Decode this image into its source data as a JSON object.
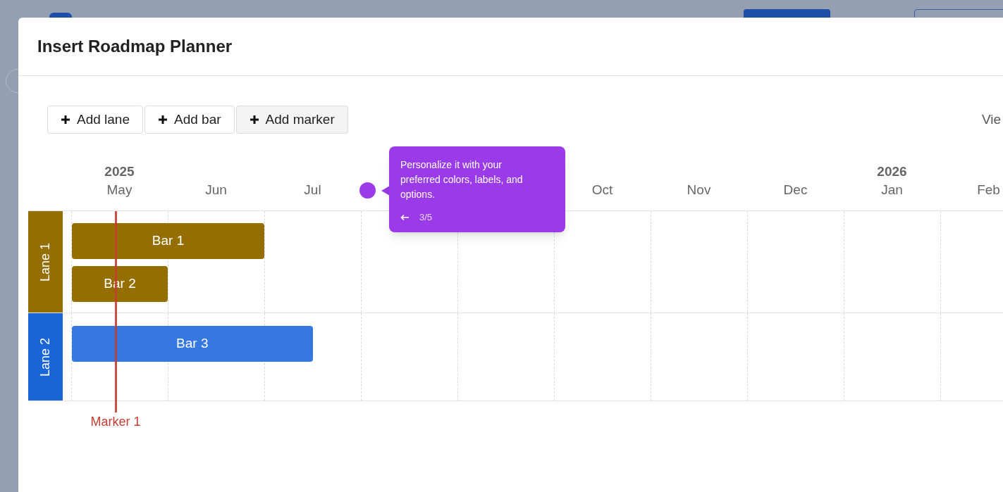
{
  "dialog": {
    "title": "Insert Roadmap Planner"
  },
  "toolbar": {
    "buttons": [
      {
        "label": "Add lane"
      },
      {
        "label": "Add bar"
      },
      {
        "label": "Add marker"
      }
    ],
    "view_label": "Vie"
  },
  "timeline": {
    "months": [
      {
        "label": "May",
        "year": "2025"
      },
      {
        "label": "Jun"
      },
      {
        "label": "Jul"
      },
      {
        "label": "Oct"
      },
      {
        "label": "Nov"
      },
      {
        "label": "Dec"
      },
      {
        "label": "Jan",
        "year": "2026"
      },
      {
        "label": "Feb"
      }
    ],
    "lanes": [
      {
        "label": "Lane 1",
        "color": "#946f00",
        "bars": [
          {
            "label": "Bar 1",
            "color": "#946f00"
          },
          {
            "label": "Bar 2",
            "color": "#946f00"
          }
        ]
      },
      {
        "label": "Lane 2",
        "color": "#1a66d9",
        "bars": [
          {
            "label": "Bar 3",
            "color": "#3579e0"
          }
        ]
      }
    ],
    "marker": {
      "label": "Marker 1",
      "color": "#c43d33"
    }
  },
  "tour_tooltip": {
    "text": "Personalize it with your preferred colors, labels, and options.",
    "step": "3/5"
  }
}
